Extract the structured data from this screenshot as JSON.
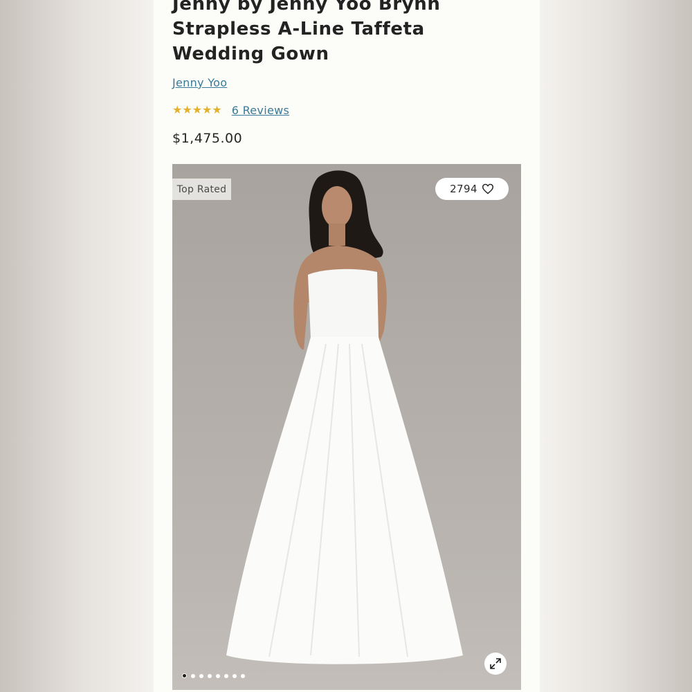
{
  "product": {
    "title": "Jenny by Jenny Yoo Brynn Strapless A-Line Taffeta Wedding Gown",
    "brand": "Jenny Yoo",
    "rating_value": 5,
    "rating_max": 5,
    "stars": "★★★★★",
    "reviews_label": "6 Reviews",
    "price": "$1,475.00"
  },
  "gallery": {
    "badge": "Top Rated",
    "favorites_count": "2794",
    "heart_icon": "heart-outline-icon",
    "expand_icon": "expand-arrows-icon",
    "dots_total": 8,
    "dots_active_index": 0
  },
  "colors": {
    "panel_bg": "#fcfcf9",
    "link": "#3a7a9a",
    "star": "#e3b22c",
    "text": "#232323"
  }
}
